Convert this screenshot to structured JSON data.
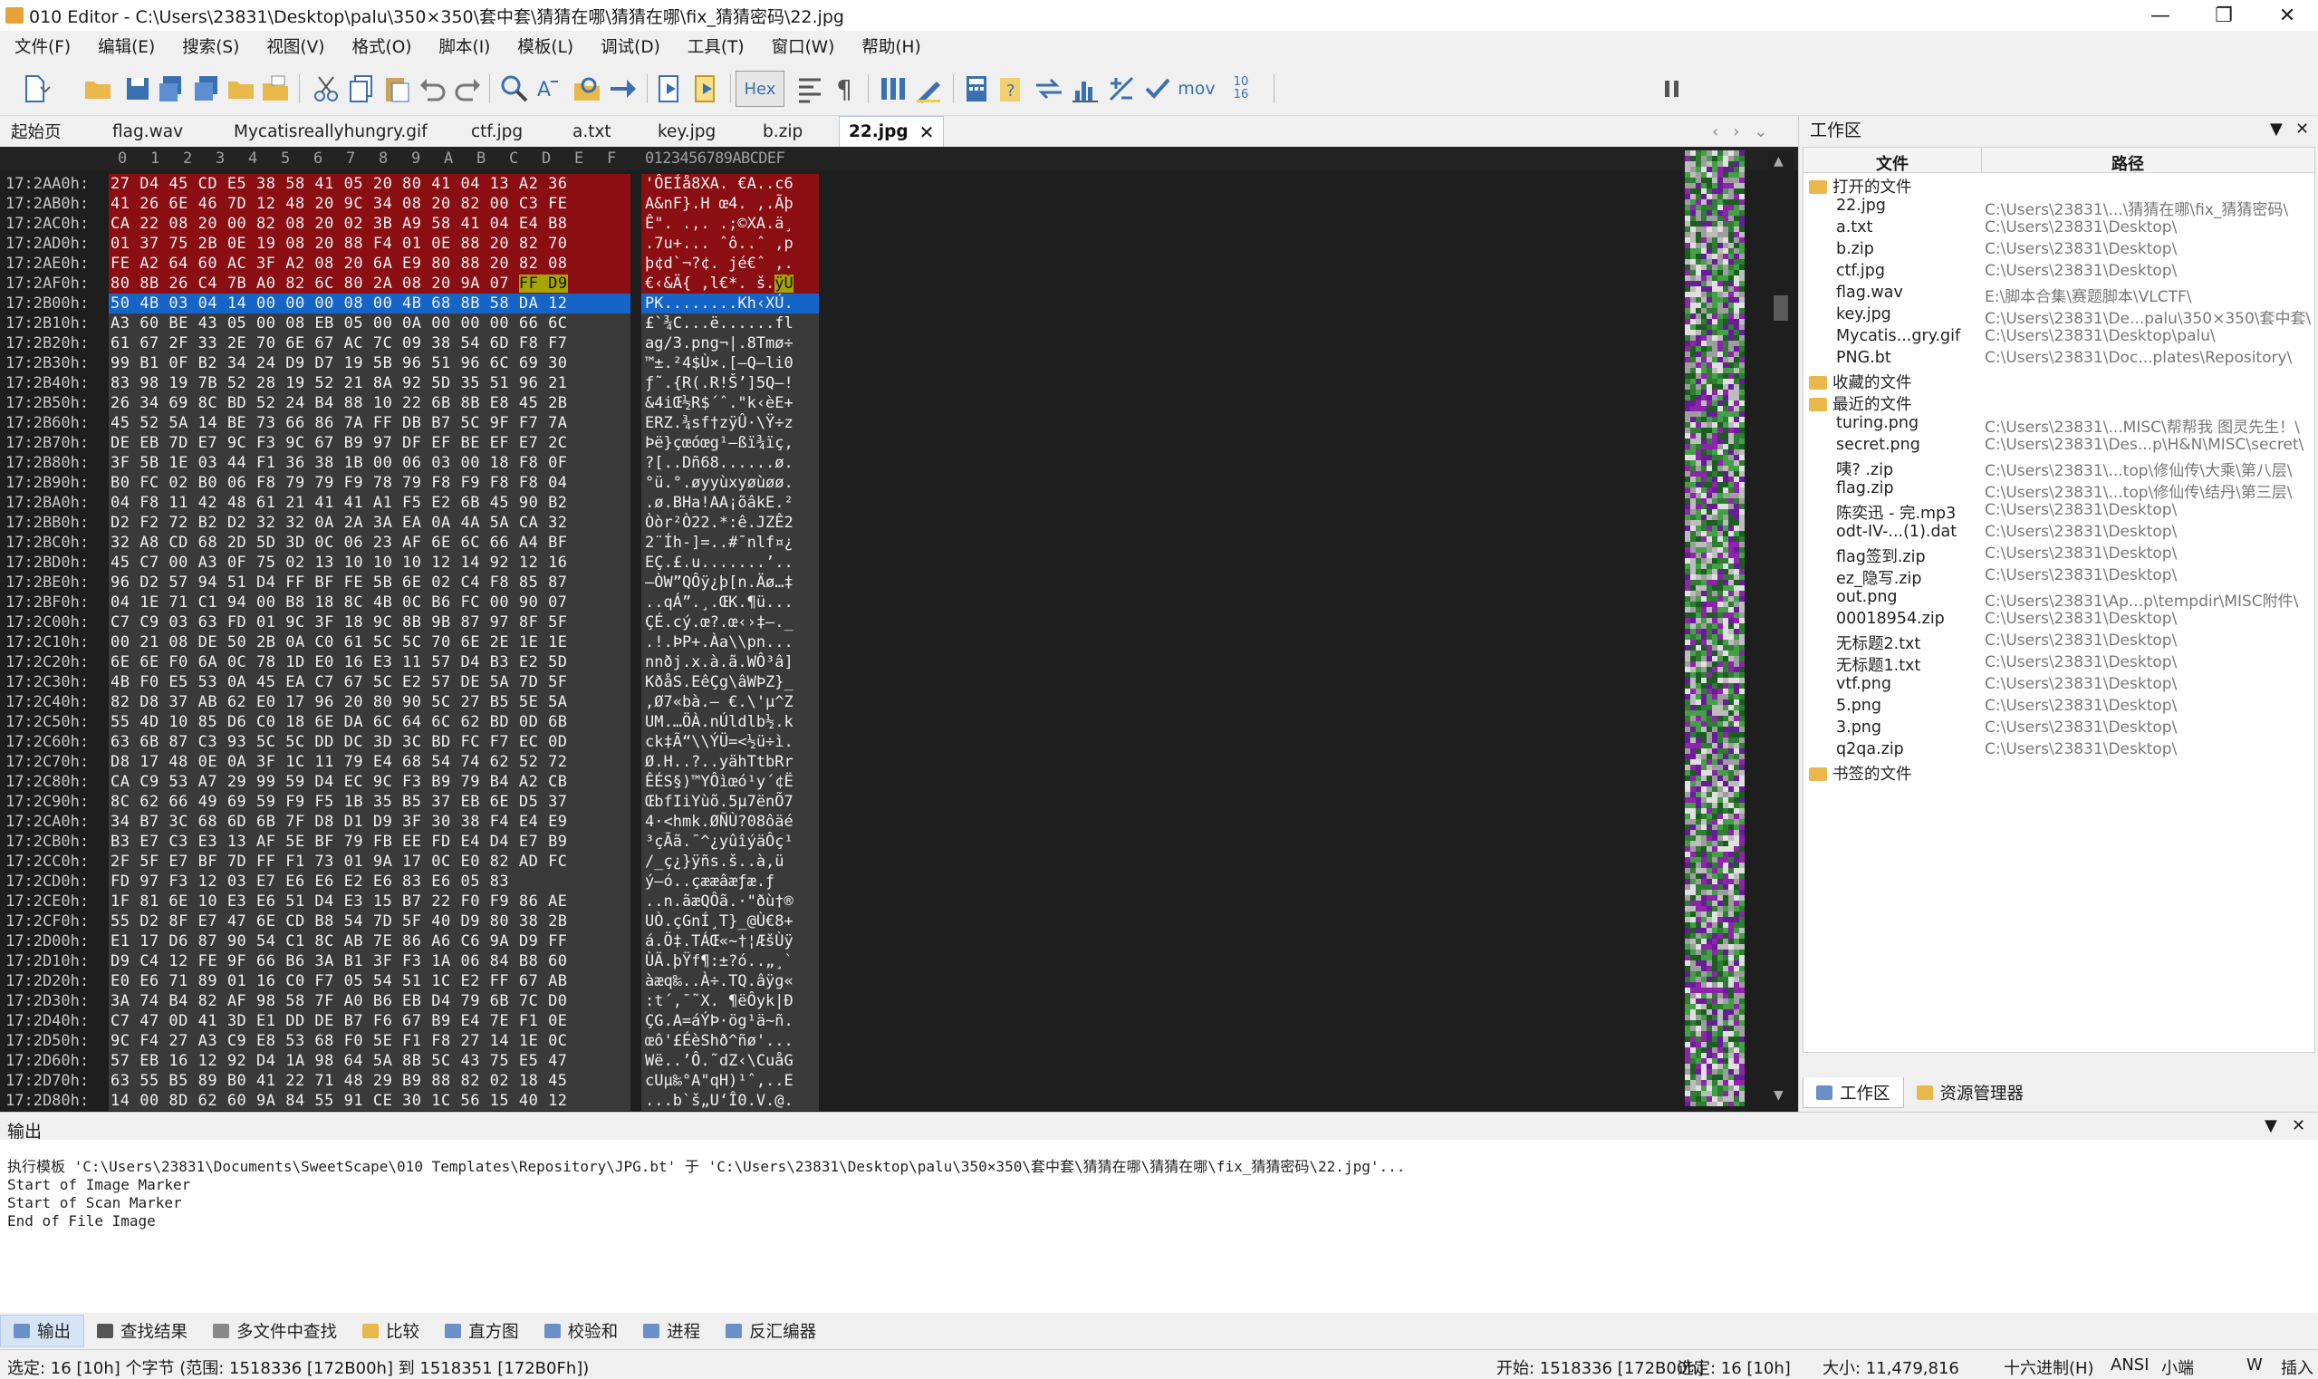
{
  "window": {
    "title": "010 Editor - C:\\Users\\23831\\Desktop\\palu\\350×350\\套中套\\猜猜在哪\\猜猜在哪\\fix_猜猜密码\\22.jpg"
  },
  "menu": [
    "文件(F)",
    "编辑(E)",
    "搜索(S)",
    "视图(V)",
    "格式(O)",
    "脚本(I)",
    "模板(L)",
    "调试(D)",
    "工具(T)",
    "窗口(W)",
    "帮助(H)"
  ],
  "toolbar": {
    "hex_label": "Hex",
    "mov_label": "mov",
    "num_top": "10",
    "num_bottom": "16"
  },
  "tabs": [
    "起始页",
    "flag.wav",
    "Mycatisreallyhungry.gif",
    "ctf.jpg",
    "a.txt",
    "key.jpg",
    "b.zip",
    "22.jpg"
  ],
  "hex": {
    "col_header": [
      "0",
      "1",
      "2",
      "3",
      "4",
      "5",
      "6",
      "7",
      "8",
      "9",
      "A",
      "B",
      "C",
      "D",
      "E",
      "F"
    ],
    "ascii_header": "0123456789ABCDEF",
    "rows": [
      {
        "addr": "17:2AA0h:",
        "hex": "27 D4 45 CD E5 38 58 41 05 20 80 41 04 13 A2 36",
        "ascii": "'ÔEÍå8XA. €A..c6",
        "style": "red"
      },
      {
        "addr": "17:2AB0h:",
        "hex": "41 26 6E 46 7D 12 48 20 9C 34 08 20 82 00 C3 FE",
        "ascii": "A&nF}.H œ4. ‚.Ãþ",
        "style": "red"
      },
      {
        "addr": "17:2AC0h:",
        "hex": "CA 22 08 20 00 82 08 20 02 3B A9 58 41 04 E4 B8",
        "ascii": "Ê\". .‚. .;©XA.ä¸",
        "style": "red"
      },
      {
        "addr": "17:2AD0h:",
        "hex": "01 37 75 2B 0E 19 08 20 88 F4 01 0E 88 20 82 70",
        "ascii": ".7u+... ˆô..ˆ ‚p",
        "style": "red"
      },
      {
        "addr": "17:2AE0h:",
        "hex": "FE A2 64 60 AC 3F A2 08 20 6A E9 80 88 20 82 08",
        "ascii": "þ¢d`¬?¢. jé€ˆ ‚.",
        "style": "red"
      },
      {
        "addr": "17:2AF0h:",
        "hex": "80 8B 26 C4 7B A0 82 6C 80 2A 08 20 9A 07 FF D9",
        "ascii": "€‹&Ä{ ‚l€*. š.ÿÙ",
        "style": "red",
        "hl_hex": "FF D9",
        "hl_asc": "ÿÙ"
      },
      {
        "addr": "17:2B00h:",
        "hex": "50 4B 03 04 14 00 00 00 08 00 4B 68 8B 58 DA 12",
        "ascii": "PK........Kh‹XÚ.",
        "style": "blue"
      },
      {
        "addr": "17:2B10h:",
        "hex": "A3 60 BE 43 05 00 08 EB 05 00 0A 00 00 00 66 6C",
        "ascii": "£`¾C...ë......fl",
        "style": "dark"
      },
      {
        "addr": "17:2B20h:",
        "hex": "61 67 2F 33 2E 70 6E 67 AC 7C 09 38 54 6D F8 F7",
        "ascii": "ag/3.png¬|.8Tmø÷",
        "style": "dark"
      },
      {
        "addr": "17:2B30h:",
        "hex": "99 B1 0F B2 34 24 D9 D7 19 5B 96 51 96 6C 69 30",
        "ascii": "™±.²4$Ù×.[–Q–li0",
        "style": "dark"
      },
      {
        "addr": "17:2B40h:",
        "hex": "83 98 19 7B 52 28 19 52 21 8A 92 5D 35 51 96 21",
        "ascii": "ƒ˜.{R(.R!Š’]5Q–!",
        "style": "dark"
      },
      {
        "addr": "17:2B50h:",
        "hex": "26 34 69 8C BD 52 24 B4 88 10 22 6B 8B E8 45 2B",
        "ascii": "&4iŒ½R$´ˆ.\"k‹èE+",
        "style": "dark"
      },
      {
        "addr": "17:2B60h:",
        "hex": "45 52 5A 14 BE 73 66 86 7A FF DB B7 5C 9F F7 7A",
        "ascii": "ERZ.¾sf†zÿÛ·\\Ÿ÷z",
        "style": "dark"
      },
      {
        "addr": "17:2B70h:",
        "hex": "DE EB 7D E7 9C F3 9C 67 B9 97 DF EF BE EF E7 2C",
        "ascii": "Þë}çœóœg¹—ßï¾ïç,",
        "style": "dark"
      },
      {
        "addr": "17:2B80h:",
        "hex": "3F 5B 1E 03 44 F1 36 38 1B 00 06 03 00 18 F8 0F",
        "ascii": "?[..Dñ68......ø.",
        "style": "dark"
      },
      {
        "addr": "17:2B90h:",
        "hex": "B0 FC 02 B0 06 F8 79 79 F9 78 79 F8 F9 F8 F8 04",
        "ascii": "°ü.°.øyyùxyøùøø.",
        "style": "dark"
      },
      {
        "addr": "17:2BA0h:",
        "hex": "04 F8 11 42 48 61 21 41 41 A1 F5 E2 6B 45 90 B2",
        "ascii": ".ø.BHa!AA¡õâkE.²",
        "style": "dark"
      },
      {
        "addr": "17:2BB0h:",
        "hex": "D2 F2 72 B2 D2 32 32 0A 2A 3A EA 0A 4A 5A CA 32",
        "ascii": "Òòr²Ò22.*:ê.JZÊ2",
        "style": "dark"
      },
      {
        "addr": "17:2BC0h:",
        "hex": "32 A8 CD 68 2D 5D 3D 0C 06 23 AF 6E 6C 66 A4 BF",
        "ascii": "2¨Íh-]=..#¯nlf¤¿",
        "style": "dark"
      },
      {
        "addr": "17:2BD0h:",
        "hex": "45 C7 00 A3 0F 75 02 13 10 10 10 12 14 92 12 16",
        "ascii": "EÇ.£.u.......’..",
        "style": "dark"
      },
      {
        "addr": "17:2BE0h:",
        "hex": "96 D2 57 94 51 D4 FF BF FE 5B 6E 02 C4 F8 85 87",
        "ascii": "–ÒW”QÔÿ¿þ[n.Äø…‡",
        "style": "dark"
      },
      {
        "addr": "17:2BF0h:",
        "hex": "04 1E 71 C1 94 00 B8 18 8C 4B 0C B6 FC 00 90 07",
        "ascii": "..qÁ”.¸.ŒK.¶ü...",
        "style": "dark"
      },
      {
        "addr": "17:2C00h:",
        "hex": "C7 C9 03 63 FD 01 9C 3F 18 9C 8B 9B 87 97 8F 5F",
        "ascii": "ÇÉ.cý.œ?.œ‹›‡—._",
        "style": "dark"
      },
      {
        "addr": "17:2C10h:",
        "hex": "00 21 08 DE 50 2B 0A C0 61 5C 5C 70 6E 2E 1E 1E",
        "ascii": ".!.ÞP+.Àa\\\\pn...",
        "style": "dark"
      },
      {
        "addr": "17:2C20h:",
        "hex": "6E 6E F0 6A 0C 78 1D E0 16 E3 11 57 D4 B3 E2 5D",
        "ascii": "nnðj.x.à.ã.WÔ³â]",
        "style": "dark"
      },
      {
        "addr": "17:2C30h:",
        "hex": "4B F0 E5 53 0A 45 EA C7 67 5C E2 57 DE 5A 7D 5F",
        "ascii": "KðåS.EêÇg\\âWÞZ}_",
        "style": "dark"
      },
      {
        "addr": "17:2C40h:",
        "hex": "82 D8 37 AB 62 E0 17 96 20 80 90 5C 27 B5 5E 5A",
        "ascii": "‚Ø7«bà.– €.\\'µ^Z",
        "style": "dark"
      },
      {
        "addr": "17:2C50h:",
        "hex": "55 4D 10 85 D6 C0 18 6E DA 6C 64 6C 62 BD 0D 6B",
        "ascii": "UM.…ÖÀ.nÚldlb½.k",
        "style": "dark"
      },
      {
        "addr": "17:2C60h:",
        "hex": "63 6B 87 C3 93 5C 5C DD DC 3D 3C BD FC F7 EC 0D",
        "ascii": "ck‡Ã“\\\\ÝÜ=<½ü÷ì.",
        "style": "dark"
      },
      {
        "addr": "17:2C70h:",
        "hex": "D8 17 48 0E 0A 3F 1C 11 79 E4 68 54 74 62 52 72",
        "ascii": "Ø.H..?..yähTtbRr",
        "style": "dark"
      },
      {
        "addr": "17:2C80h:",
        "hex": "CA C9 53 A7 29 99 59 D4 EC 9C F3 B9 79 B4 A2 CB",
        "ascii": "ÊÉS§)™YÔìœó¹y´¢Ë",
        "style": "dark"
      },
      {
        "addr": "17:2C90h:",
        "hex": "8C 62 66 49 69 59 F9 F5 1B 35 B5 37 EB 6E D5 37",
        "ascii": "ŒbfIiYùõ.5µ7ënÕ7",
        "style": "dark"
      },
      {
        "addr": "17:2CA0h:",
        "hex": "34 B7 3C 68 6D 6B 7F D8 D1 D9 3F 30 38 F4 E4 E9",
        "ascii": "4·<hmk.ØÑÙ?08ôäé",
        "style": "dark"
      },
      {
        "addr": "17:2CB0h:",
        "hex": "B3 E7 C3 E3 13 AF 5E BF 79 FB EE FD E4 D4 E7 B9",
        "ascii": "³çÃã.¯^¿yûîýäÔç¹",
        "style": "dark"
      },
      {
        "addr": "17:2CC0h:",
        "hex": "2F 5F E7 BF 7D FF F1 73 01 9A 17 0C E0 82 AD FC",
        "ascii": "/_ç¿}ÿñs.š..à‚­ü",
        "style": "dark"
      },
      {
        "addr": "17:2CD0h:",
        "hex": "FD 97 F3 12 03 E7 E6 E6 E2 E6 83 E6 05 83",
        "ascii": "ý—ó..çææâæƒæ.ƒ",
        "style": "dark"
      },
      {
        "addr": "17:2CE0h:",
        "hex": "1F 81 6E 10 E3 E6 51 D4 E3 15 B7 22 F0 F9 86 AE",
        "ascii": "..n.ãæQÔã.·\"ðù†®",
        "style": "dark"
      },
      {
        "addr": "17:2CF0h:",
        "hex": "55 D2 8F E7 47 6E CD B8 54 7D 5F 40 D9 80 38 2B",
        "ascii": "UÒ.çGnÍ¸T}_@Ù€8+",
        "style": "dark"
      },
      {
        "addr": "17:2D00h:",
        "hex": "E1 17 D6 87 90 54 C1 8C AB 7E 86 A6 C6 9A D9 FF",
        "ascii": "á.Ö‡.TÁŒ«~†¦ÆšÙÿ",
        "style": "dark"
      },
      {
        "addr": "17:2D10h:",
        "hex": "D9 C4 12 FE 9F 66 B6 3A B1 3F F3 1A 06 84 B8 60",
        "ascii": "ÙÄ.þŸf¶:±?ó..„¸`",
        "style": "dark"
      },
      {
        "addr": "17:2D20h:",
        "hex": "E0 E6 71 89 01 16 C0 F7 05 54 51 1C E2 FF 67 AB",
        "ascii": "àæq‰..À÷.TQ.âÿg«",
        "style": "dark"
      },
      {
        "addr": "17:2D30h:",
        "hex": "3A 74 B4 82 AF 98 58 7F A0 B6 EB D4 79 6B 7C D0",
        "ascii": ":t´‚¯˜X. ¶ëÔyk|Ð",
        "style": "dark"
      },
      {
        "addr": "17:2D40h:",
        "hex": "C7 47 0D 41 3D E1 DD DE B7 F6 67 B9 E4 7E F1 0E",
        "ascii": "ÇG.A=áÝÞ·ög¹ä~ñ.",
        "style": "dark"
      },
      {
        "addr": "17:2D50h:",
        "hex": "9C F4 27 A3 C9 E8 53 68 F0 5E F1 F8 27 14 1E 0C",
        "ascii": "œô'£ÉèShð^ñø'...",
        "style": "dark"
      },
      {
        "addr": "17:2D60h:",
        "hex": "57 EB 16 12 92 D4 1A 98 64 5A 8B 5C 43 75 E5 47",
        "ascii": "Wë..’Ô.˜dZ‹\\CuåG",
        "style": "dark"
      },
      {
        "addr": "17:2D70h:",
        "hex": "63 55 B5 89 B0 41 22 71 48 29 B9 88 82 02 18 45",
        "ascii": "cUµ‰°A\"qH)¹ˆ‚..E",
        "style": "dark"
      },
      {
        "addr": "17:2D80h:",
        "hex": "14 00 8D 62 60 9A 84 55 91 CE 30 1C 56 15 40 12",
        "ascii": "...b`š„U‘Î0.V.@.",
        "style": "dark"
      }
    ]
  },
  "workspace": {
    "title": "工作区",
    "col_file": "文件",
    "col_path": "路径",
    "groups": {
      "open": "打开的文件",
      "fav": "收藏的文件",
      "recent": "最近的文件",
      "bookmark": "书签的文件"
    },
    "open_files": [
      {
        "name": "22.jpg",
        "path": "C:\\Users\\23831\\...\\猜猜在哪\\fix_猜猜密码\\"
      },
      {
        "name": "a.txt",
        "path": "C:\\Users\\23831\\Desktop\\"
      },
      {
        "name": "b.zip",
        "path": "C:\\Users\\23831\\Desktop\\"
      },
      {
        "name": "ctf.jpg",
        "path": "C:\\Users\\23831\\Desktop\\"
      },
      {
        "name": "flag.wav",
        "path": "E:\\脚本合集\\赛题脚本\\VLCTF\\"
      },
      {
        "name": "key.jpg",
        "path": "C:\\Users\\23831\\De...palu\\350×350\\套中套\\"
      },
      {
        "name": "Mycatis...gry.gif",
        "path": "C:\\Users\\23831\\Desktop\\palu\\"
      },
      {
        "name": "PNG.bt",
        "path": "C:\\Users\\23831\\Doc...plates\\Repository\\"
      }
    ],
    "recent_files": [
      {
        "name": "turing.png",
        "path": "C:\\Users\\23831\\...MISC\\帮帮我 图灵先生！\\"
      },
      {
        "name": "secret.png",
        "path": "C:\\Users\\23831\\Des...p\\H&N\\MISC\\secret\\"
      },
      {
        "name": "咦? .zip",
        "path": "C:\\Users\\23831\\...top\\修仙传\\大乘\\第八层\\"
      },
      {
        "name": "flag.zip",
        "path": "C:\\Users\\23831\\...top\\修仙传\\结丹\\第三层\\"
      },
      {
        "name": "陈奕迅 - 完.mp3",
        "path": "C:\\Users\\23831\\Desktop\\"
      },
      {
        "name": "odt-IV-...(1).dat",
        "path": "C:\\Users\\23831\\Desktop\\"
      },
      {
        "name": "flag签到.zip",
        "path": "C:\\Users\\23831\\Desktop\\"
      },
      {
        "name": "ez_隐写.zip",
        "path": "C:\\Users\\23831\\Desktop\\"
      },
      {
        "name": "out.png",
        "path": "C:\\Users\\23831\\Ap...p\\tempdir\\MISC附件\\"
      },
      {
        "name": "00018954.zip",
        "path": "C:\\Users\\23831\\Desktop\\"
      },
      {
        "name": "无标题2.txt",
        "path": "C:\\Users\\23831\\Desktop\\"
      },
      {
        "name": "无标题1.txt",
        "path": "C:\\Users\\23831\\Desktop\\"
      },
      {
        "name": "vtf.png",
        "path": "C:\\Users\\23831\\Desktop\\"
      },
      {
        "name": "5.png",
        "path": "C:\\Users\\23831\\Desktop\\"
      },
      {
        "name": "3.png",
        "path": "C:\\Users\\23831\\Desktop\\"
      },
      {
        "name": "q2qa.zip",
        "path": "C:\\Users\\23831\\Desktop\\"
      }
    ],
    "tab_workspace": "工作区",
    "tab_explorer": "资源管理器"
  },
  "output": {
    "title": "输出",
    "lines": [
      "执行模板 'C:\\Users\\23831\\Documents\\SweetScape\\010 Templates\\Repository\\JPG.bt' 于 'C:\\Users\\23831\\Desktop\\palu\\350×350\\套中套\\猜猜在哪\\猜猜在哪\\fix_猜猜密码\\22.jpg'...",
      "Start of Image Marker",
      "Start of Scan Marker",
      "End of File Image"
    ]
  },
  "bottom_tabs": [
    "输出",
    "查找结果",
    "多文件中查找",
    "比较",
    "直方图",
    "校验和",
    "进程",
    "反汇编器"
  ],
  "status": {
    "selection": "选定: 16 [10h] 个字节 (范围: 1518336 [172B00h] 到 1518351 [172B0Fh])",
    "start": "开始: 1518336 [172B00h]",
    "sel": "选定: 16 [10h]",
    "size": "大小: 11,479,816",
    "mode": "十六进制(H)",
    "encoding": "ANSI",
    "endian": "小端",
    "insert1": "W",
    "insert2": "插入"
  },
  "colors": {
    "red_block": "#8a0e12",
    "blue_block": "#1565c8",
    "dark_bg": "#1e1e1e",
    "highlight": "#a6a400"
  }
}
